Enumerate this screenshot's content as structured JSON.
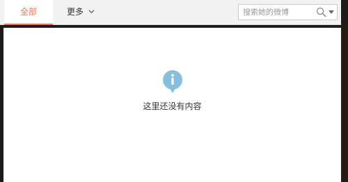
{
  "tabs": {
    "all_label": "全部",
    "more_label": "更多"
  },
  "search": {
    "placeholder": "搜索她的微博",
    "value": ""
  },
  "empty_state": {
    "icon": "info-icon",
    "message": "这里还没有内容"
  },
  "colors": {
    "accent": "#eb7350",
    "info_icon": "#86bfdd",
    "frame": "#1e1a17"
  }
}
